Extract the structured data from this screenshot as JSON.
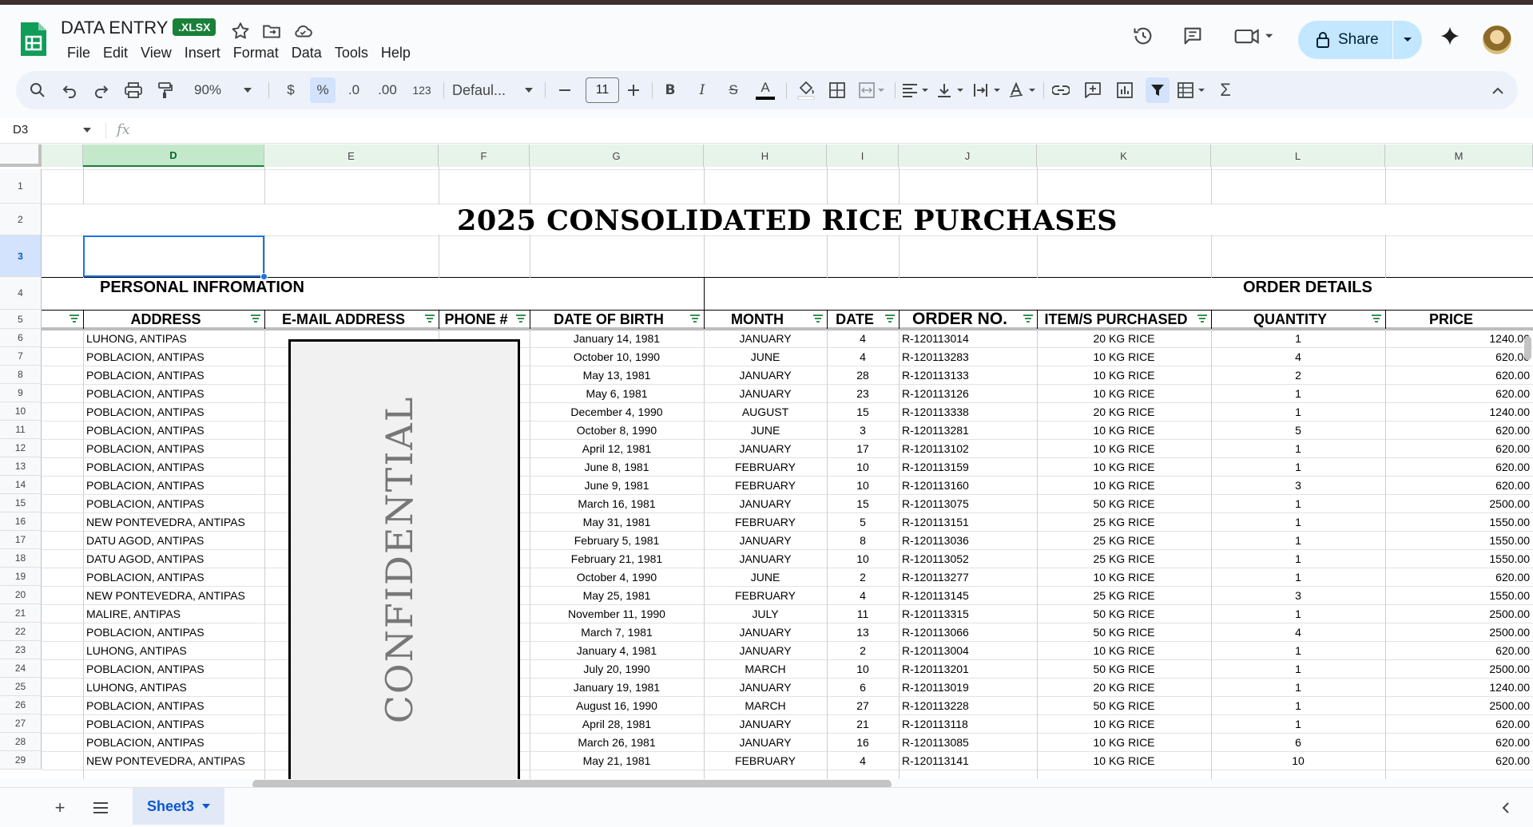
{
  "app": {
    "doc_title": "DATA ENTRY",
    "file_badge": "XLSX",
    "menu": [
      "File",
      "Edit",
      "View",
      "Insert",
      "Format",
      "Data",
      "Tools",
      "Help"
    ],
    "share_label": "Share",
    "accent_color": "#c2e7ff",
    "brand_color": "#188038"
  },
  "toolbar": {
    "zoom": "90%",
    "currency": "$",
    "percent": "%",
    "dec_decrease": ".0",
    "dec_increase": ".00",
    "number_format": "123",
    "font": "Defaul...",
    "font_size": "11"
  },
  "formula_bar": {
    "cell_ref": "D3",
    "fx": "fx",
    "value": ""
  },
  "columns": [
    "D",
    "E",
    "F",
    "G",
    "H",
    "I",
    "J",
    "K",
    "L",
    "M"
  ],
  "row_numbers": [
    "1",
    "2",
    "3",
    "4",
    "5",
    "6",
    "7",
    "8",
    "9",
    "10",
    "11",
    "12",
    "13",
    "14",
    "15",
    "16",
    "17",
    "18",
    "19",
    "20",
    "21",
    "22",
    "23",
    "24",
    "25",
    "26",
    "27",
    "28",
    "29"
  ],
  "sheet": {
    "title": "2025 CONSOLIDATED RICE PURCHASES",
    "section_personal": "PERSONAL INFROMATION",
    "section_order": "ORDER DETAILS",
    "headers": {
      "address": "ADDRESS",
      "email": "E-MAIL ADDRESS",
      "phone": "PHONE #",
      "dob": "DATE OF BIRTH",
      "month": "MONTH",
      "date": "DATE",
      "order_no": "ORDER NO.",
      "items": "ITEM/S PURCHASED",
      "quantity": "QUANTITY",
      "price": "PRICE"
    },
    "confidential_label": "CONFIDENTIAL",
    "rows": [
      [
        "LUHONG, ANTIPAS",
        "January 14, 1981",
        "JANUARY",
        "4",
        "R-120113014",
        "20 KG RICE",
        "1",
        "1240.00"
      ],
      [
        "POBLACION, ANTIPAS",
        "October 10, 1990",
        "JUNE",
        "4",
        "R-120113283",
        "10 KG RICE",
        "4",
        "620.00"
      ],
      [
        "POBLACION, ANTIPAS",
        "May 13, 1981",
        "JANUARY",
        "28",
        "R-120113133",
        "10 KG RICE",
        "2",
        "620.00"
      ],
      [
        "POBLACION, ANTIPAS",
        "May 6, 1981",
        "JANUARY",
        "23",
        "R-120113126",
        "10 KG RICE",
        "1",
        "620.00"
      ],
      [
        "POBLACION, ANTIPAS",
        "December 4, 1990",
        "AUGUST",
        "15",
        "R-120113338",
        "20 KG RICE",
        "1",
        "1240.00"
      ],
      [
        "POBLACION, ANTIPAS",
        "October 8, 1990",
        "JUNE",
        "3",
        "R-120113281",
        "10 KG RICE",
        "5",
        "620.00"
      ],
      [
        "POBLACION, ANTIPAS",
        "April 12, 1981",
        "JANUARY",
        "17",
        "R-120113102",
        "10 KG RICE",
        "1",
        "620.00"
      ],
      [
        "POBLACION, ANTIPAS",
        "June 8, 1981",
        "FEBRUARY",
        "10",
        "R-120113159",
        "10 KG RICE",
        "1",
        "620.00"
      ],
      [
        "POBLACION, ANTIPAS",
        "June 9, 1981",
        "FEBRUARY",
        "10",
        "R-120113160",
        "10 KG RICE",
        "3",
        "620.00"
      ],
      [
        "POBLACION, ANTIPAS",
        "March 16, 1981",
        "JANUARY",
        "15",
        "R-120113075",
        "50 KG RICE",
        "1",
        "2500.00"
      ],
      [
        "NEW PONTEVEDRA, ANTIPAS",
        "May 31, 1981",
        "FEBRUARY",
        "5",
        "R-120113151",
        "25 KG RICE",
        "1",
        "1550.00"
      ],
      [
        "DATU AGOD, ANTIPAS",
        "February 5, 1981",
        "JANUARY",
        "8",
        "R-120113036",
        "25 KG RICE",
        "1",
        "1550.00"
      ],
      [
        "DATU AGOD, ANTIPAS",
        "February 21, 1981",
        "JANUARY",
        "10",
        "R-120113052",
        "25 KG RICE",
        "1",
        "1550.00"
      ],
      [
        "POBLACION, ANTIPAS",
        "October 4, 1990",
        "JUNE",
        "2",
        "R-120113277",
        "10 KG RICE",
        "1",
        "620.00"
      ],
      [
        "NEW PONTEVEDRA, ANTIPAS",
        "May 25, 1981",
        "FEBRUARY",
        "4",
        "R-120113145",
        "25 KG RICE",
        "3",
        "1550.00"
      ],
      [
        "MALIRE, ANTIPAS",
        "November 11, 1990",
        "JULY",
        "11",
        "R-120113315",
        "50 KG RICE",
        "1",
        "2500.00"
      ],
      [
        "POBLACION, ANTIPAS",
        "March 7, 1981",
        "JANUARY",
        "13",
        "R-120113066",
        "50 KG RICE",
        "4",
        "2500.00"
      ],
      [
        "LUHONG, ANTIPAS",
        "January 4, 1981",
        "JANUARY",
        "2",
        "R-120113004",
        "10 KG RICE",
        "1",
        "620.00"
      ],
      [
        "POBLACION, ANTIPAS",
        "July 20, 1990",
        "MARCH",
        "10",
        "R-120113201",
        "50 KG RICE",
        "1",
        "2500.00"
      ],
      [
        "LUHONG, ANTIPAS",
        "January 19, 1981",
        "JANUARY",
        "6",
        "R-120113019",
        "20 KG RICE",
        "1",
        "1240.00"
      ],
      [
        "POBLACION, ANTIPAS",
        "August 16, 1990",
        "MARCH",
        "27",
        "R-120113228",
        "50 KG RICE",
        "1",
        "2500.00"
      ],
      [
        "POBLACION, ANTIPAS",
        "April 28, 1981",
        "JANUARY",
        "21",
        "R-120113118",
        "10 KG RICE",
        "1",
        "620.00"
      ],
      [
        "POBLACION, ANTIPAS",
        "March 26, 1981",
        "JANUARY",
        "16",
        "R-120113085",
        "10 KG RICE",
        "6",
        "620.00"
      ],
      [
        "NEW PONTEVEDRA, ANTIPAS",
        "May 21, 1981",
        "FEBRUARY",
        "4",
        "R-120113141",
        "10 KG RICE",
        "10",
        "620.00"
      ]
    ]
  },
  "sheet_tabs": {
    "active": "Sheet3"
  }
}
